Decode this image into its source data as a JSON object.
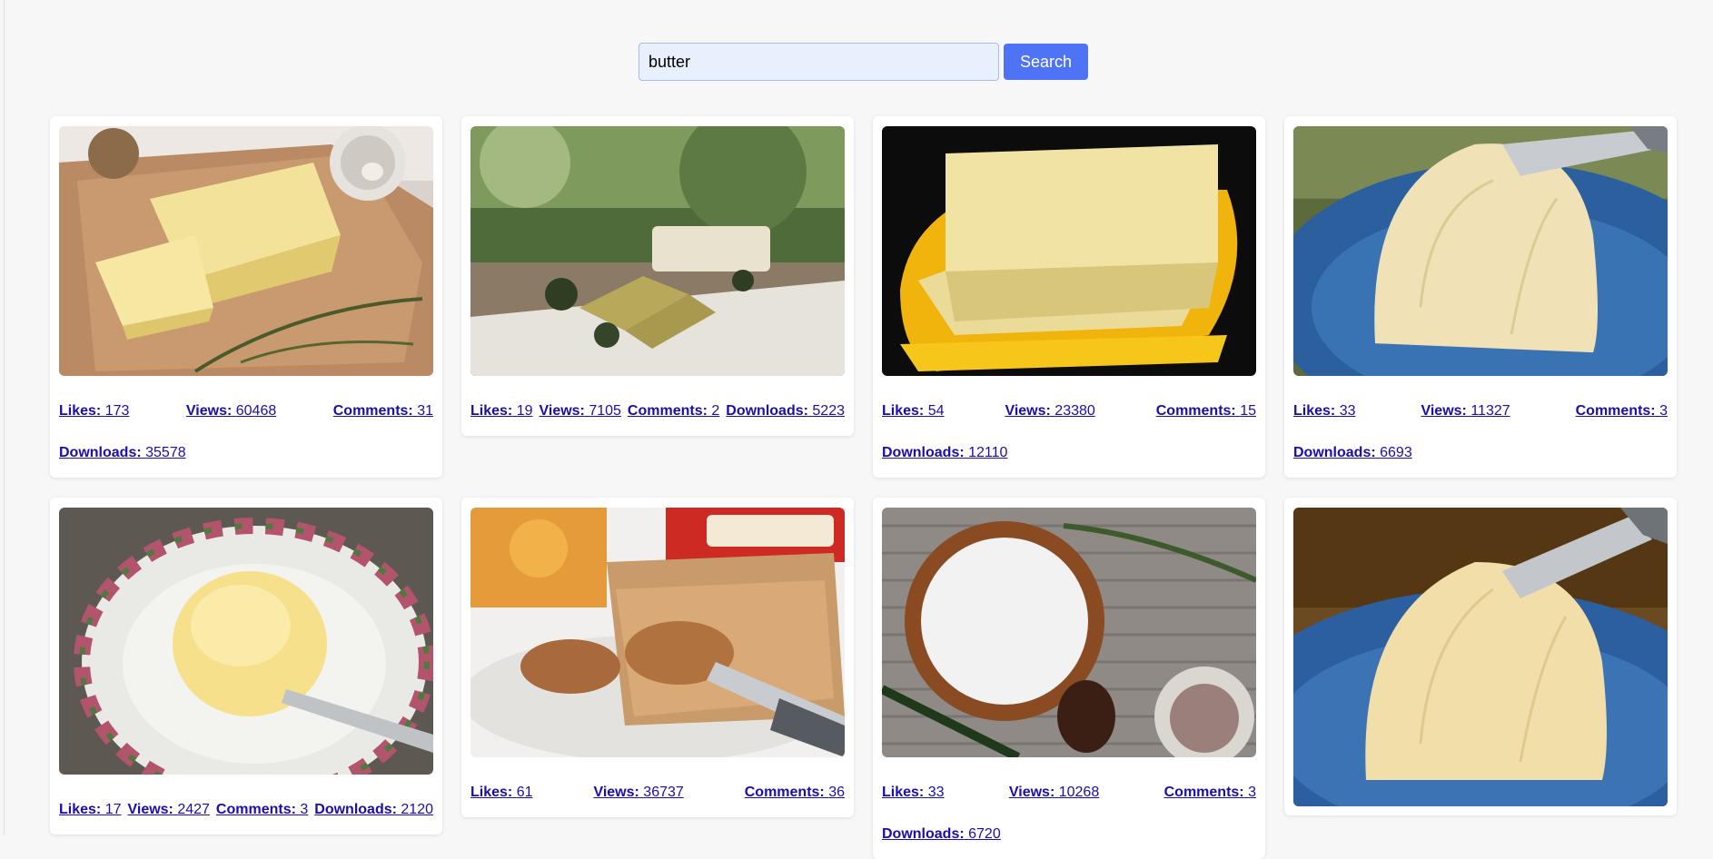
{
  "search": {
    "value": "butter",
    "button_label": "Search"
  },
  "labels": {
    "likes": "Likes:",
    "views": "Views:",
    "comments": "Comments:",
    "downloads": "Downloads:"
  },
  "cards": [
    {
      "likes": "173",
      "views": "60468",
      "comments": "31",
      "downloads": "35578",
      "image": "butter-block-on-paper"
    },
    {
      "likes": "19",
      "views": "7105",
      "comments": "2",
      "downloads": "5223",
      "image": "herbal-butter-bars-outdoors"
    },
    {
      "likes": "54",
      "views": "23380",
      "comments": "15",
      "downloads": "12110",
      "image": "butter-on-yellow-dish"
    },
    {
      "likes": "33",
      "views": "11327",
      "comments": "3",
      "downloads": "6693",
      "image": "butter-dome-blue-plate-knife"
    },
    {
      "likes": "17",
      "views": "2427",
      "comments": "3",
      "downloads": "2120",
      "image": "butter-on-floral-plate"
    },
    {
      "likes": "61",
      "views": "36737",
      "comments": "36",
      "downloads": "",
      "image": "peanut-butter-toast"
    },
    {
      "likes": "33",
      "views": "10268",
      "comments": "3",
      "downloads": "6720",
      "image": "cream-bowl-on-mat"
    },
    {
      "likes": "",
      "views": "",
      "comments": "",
      "downloads": "",
      "image": "butter-dome-blue-plate"
    }
  ]
}
